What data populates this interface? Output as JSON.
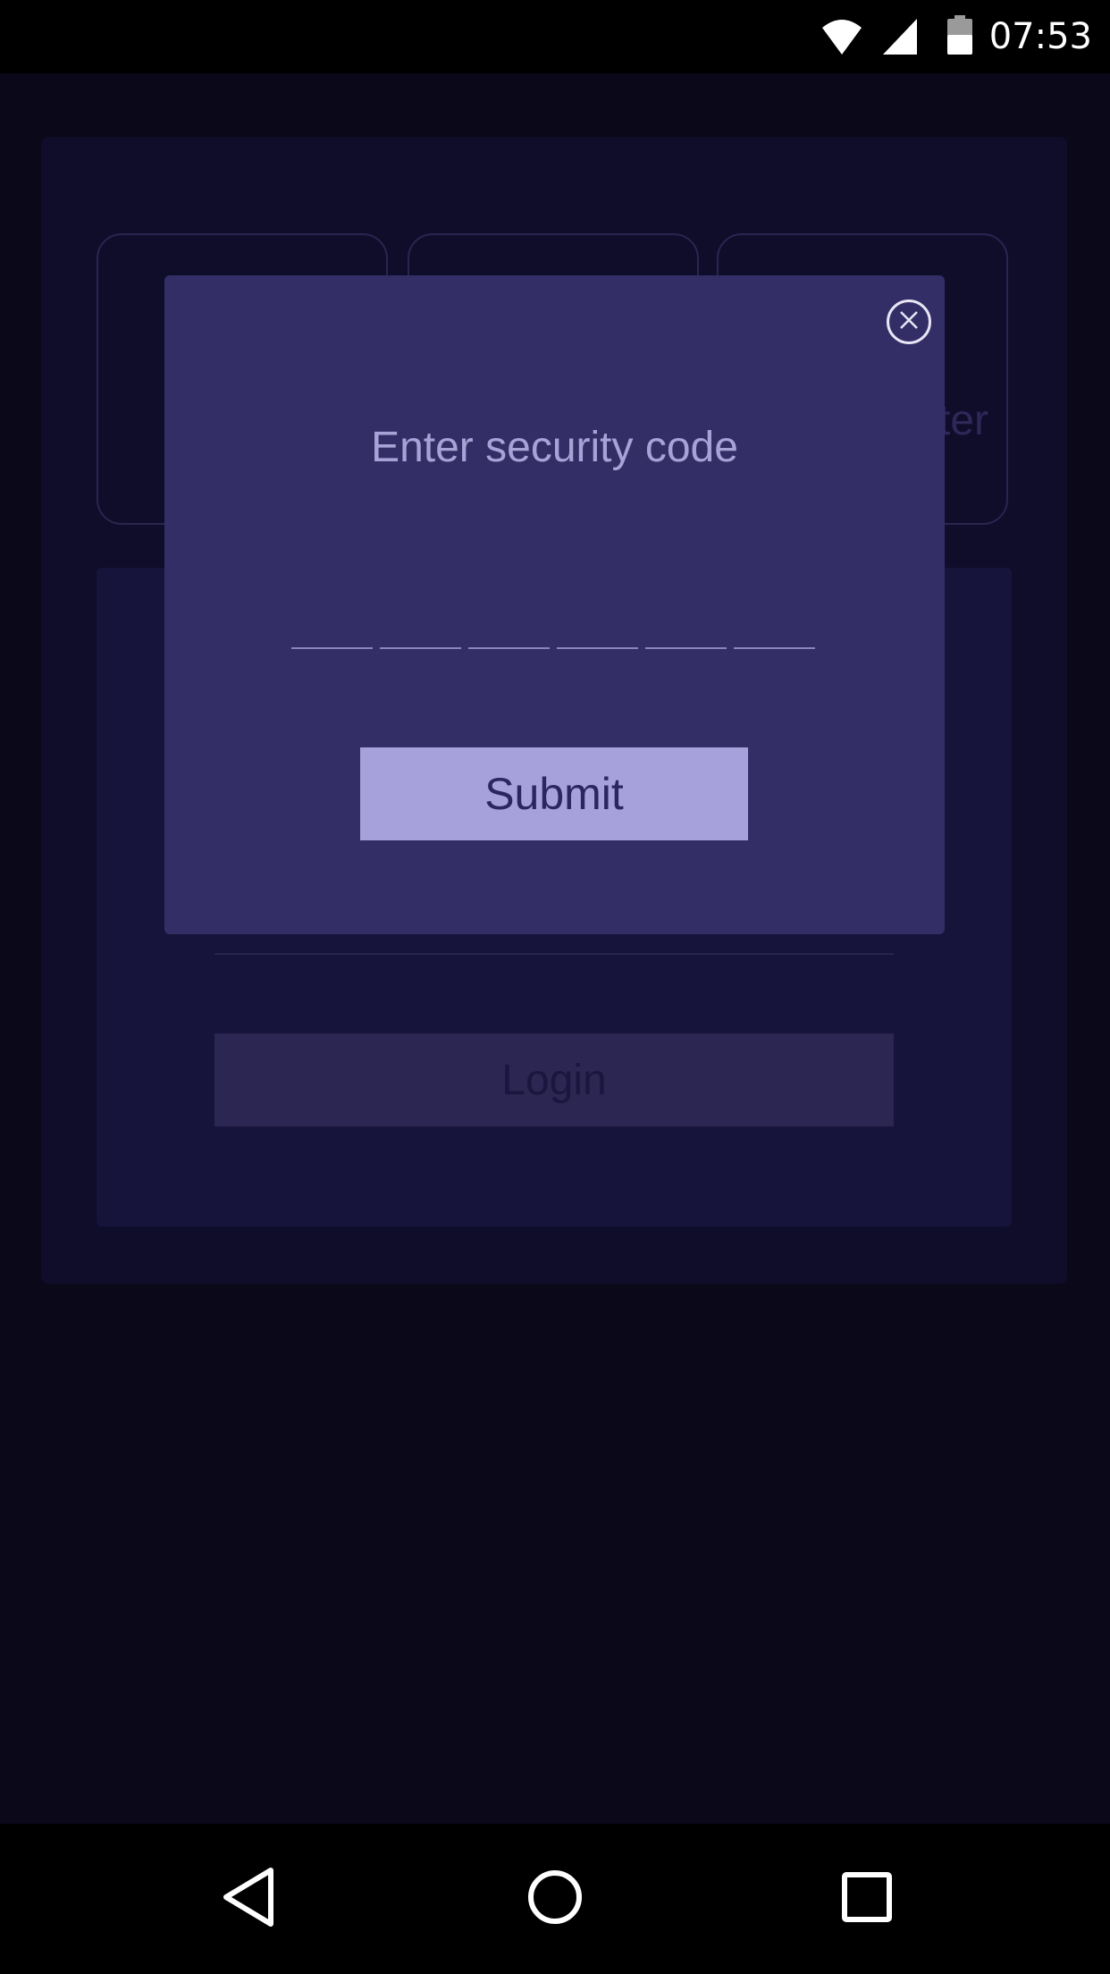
{
  "status_bar": {
    "time": "07:53",
    "icons": [
      "wifi-icon",
      "cell-signal-icon",
      "battery-icon"
    ]
  },
  "background": {
    "tiles": [
      {
        "label": ""
      },
      {
        "label": ""
      },
      {
        "label": "ter"
      }
    ],
    "login_label": "Login"
  },
  "modal": {
    "title": "Enter security code",
    "code_length": 6,
    "code_values": [
      "",
      "",
      "",
      "",
      "",
      ""
    ],
    "submit_label": "Submit",
    "close_icon": "close-icon"
  },
  "nav_bar": {
    "buttons": [
      "back-icon",
      "home-icon",
      "recents-icon"
    ]
  },
  "colors": {
    "page_background": "#0a0819",
    "modal_background": "#342e67",
    "submit_button": "#a6a0db",
    "title_text": "#a7a3d6"
  }
}
